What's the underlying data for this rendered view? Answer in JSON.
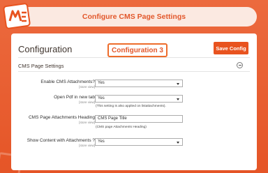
{
  "header": {
    "title": "Configure CMS Page Settings"
  },
  "callout": {
    "label": "Configuration 3"
  },
  "page": {
    "heading": "Configuration",
    "save_label": "Save Config"
  },
  "section": {
    "title": "CMS Page Settings",
    "collapse_icon": "minus-circle-icon"
  },
  "fields": {
    "enable_attachments": {
      "label": "Enable CMS Attachments?",
      "scope": "[store view]",
      "value": "Yes"
    },
    "open_pdf": {
      "label": "Open Pdf in new tab",
      "scope": "[store view]",
      "value": "Yes",
      "note": "(This setting is also applied on listattachments)."
    },
    "heading": {
      "label": "CMS Page Attachments Heading",
      "scope": "[store view]",
      "value": "CMS Page Title",
      "note": "(CMS page Attachments Heading)"
    },
    "show_content": {
      "label": "Show Content with Attachments ?",
      "scope": "[store view]",
      "value": "Yes"
    }
  },
  "colors": {
    "accent": "#e8531f",
    "background": "#e9582c",
    "header_bg": "#fbe9e1"
  }
}
